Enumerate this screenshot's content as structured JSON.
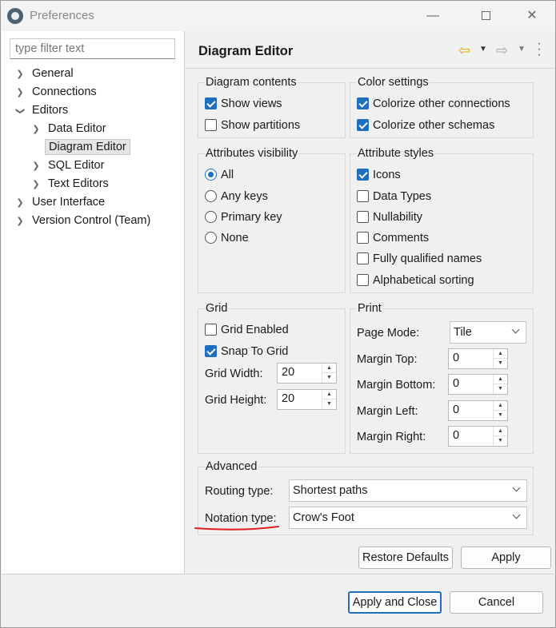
{
  "window": {
    "title": "Preferences"
  },
  "filter": {
    "placeholder": "type filter text"
  },
  "tree": {
    "general": "General",
    "connections": "Connections",
    "editors": "Editors",
    "data_editor": "Data Editor",
    "diagram_editor": "Diagram Editor",
    "sql_editor": "SQL Editor",
    "text_editors": "Text Editors",
    "user_interface": "User Interface",
    "version_control": "Version Control (Team)",
    "selected": "Diagram Editor"
  },
  "page": {
    "title": "Diagram Editor"
  },
  "diagram_contents": {
    "title": "Diagram contents",
    "show_views": {
      "label": "Show views",
      "checked": true
    },
    "show_partitions": {
      "label": "Show partitions",
      "checked": false
    }
  },
  "color_settings": {
    "title": "Color settings",
    "colorize_connections": {
      "label": "Colorize other connections",
      "checked": true
    },
    "colorize_schemas": {
      "label": "Colorize other schemas",
      "checked": true
    }
  },
  "attributes_visibility": {
    "title": "Attributes visibility",
    "options": [
      "All",
      "Any keys",
      "Primary key",
      "None"
    ],
    "selected": "All"
  },
  "attribute_styles": {
    "title": "Attribute styles",
    "icons": {
      "label": "Icons",
      "checked": true
    },
    "data_types": {
      "label": "Data Types",
      "checked": false
    },
    "nullability": {
      "label": "Nullability",
      "checked": false
    },
    "comments": {
      "label": "Comments",
      "checked": false
    },
    "fully_qualified": {
      "label": "Fully qualified names",
      "checked": false
    },
    "alphabetical": {
      "label": "Alphabetical sorting",
      "checked": false
    }
  },
  "grid": {
    "title": "Grid",
    "enabled": {
      "label": "Grid Enabled",
      "checked": false
    },
    "snap": {
      "label": "Snap To Grid",
      "checked": true
    },
    "width_label": "Grid Width:",
    "width_value": "20",
    "height_label": "Grid Height:",
    "height_value": "20"
  },
  "print": {
    "title": "Print",
    "page_mode_label": "Page Mode:",
    "page_mode_value": "Tile",
    "margin_top_label": "Margin Top:",
    "margin_top_value": "0",
    "margin_bottom_label": "Margin Bottom:",
    "margin_bottom_value": "0",
    "margin_left_label": "Margin Left:",
    "margin_left_value": "0",
    "margin_right_label": "Margin Right:",
    "margin_right_value": "0"
  },
  "advanced": {
    "title": "Advanced",
    "routing_label": "Routing type:",
    "routing_value": "Shortest paths",
    "notation_label": "Notation type:",
    "notation_value": "Crow's Foot"
  },
  "buttons": {
    "restore_defaults": "Restore Defaults",
    "apply": "Apply",
    "apply_and_close": "Apply and Close",
    "cancel": "Cancel"
  },
  "colors": {
    "accent": "#1f6fc1",
    "back_arrow": "#e0b000",
    "annotation_underline": "#e02020"
  },
  "icons": [
    "app-icon",
    "back-arrow-icon",
    "forward-arrow-icon",
    "more-vertical-icon",
    "chevron-down-icon",
    "chevron-right-icon"
  ]
}
